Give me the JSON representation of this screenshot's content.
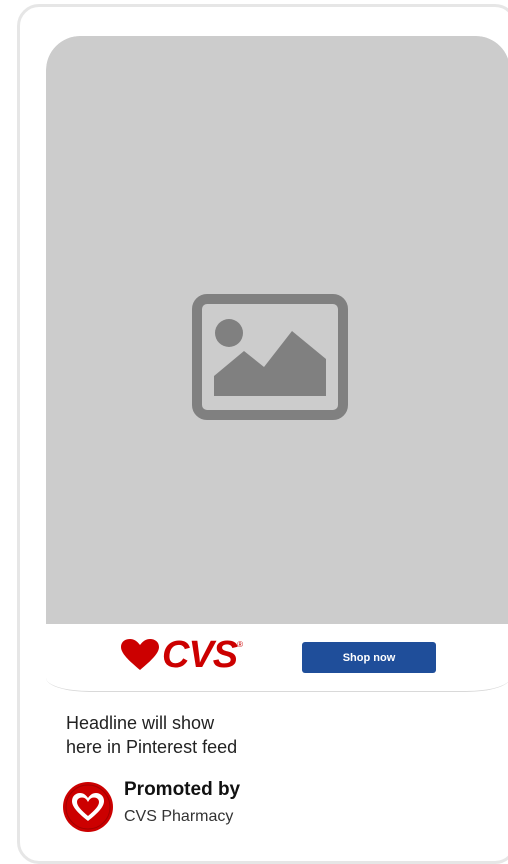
{
  "pin": {
    "media": {
      "icon": "image-placeholder-icon",
      "background_color": "#cccccc",
      "icon_color": "#808080"
    },
    "cta_bar": {
      "brand_text": "CVS",
      "brand_reg_mark": "®",
      "brand_color": "#cc0000",
      "brand_icon": "heart-icon",
      "button_label": "Shop now",
      "button_color": "#1f4e9a"
    },
    "headline": {
      "line1": "Headline will show",
      "line2": "here in Pinterest feed"
    },
    "promoted": {
      "label": "Promoted by",
      "advertiser": "CVS Pharmacy",
      "avatar_icon": "cvs-heart-avatar-icon"
    }
  }
}
